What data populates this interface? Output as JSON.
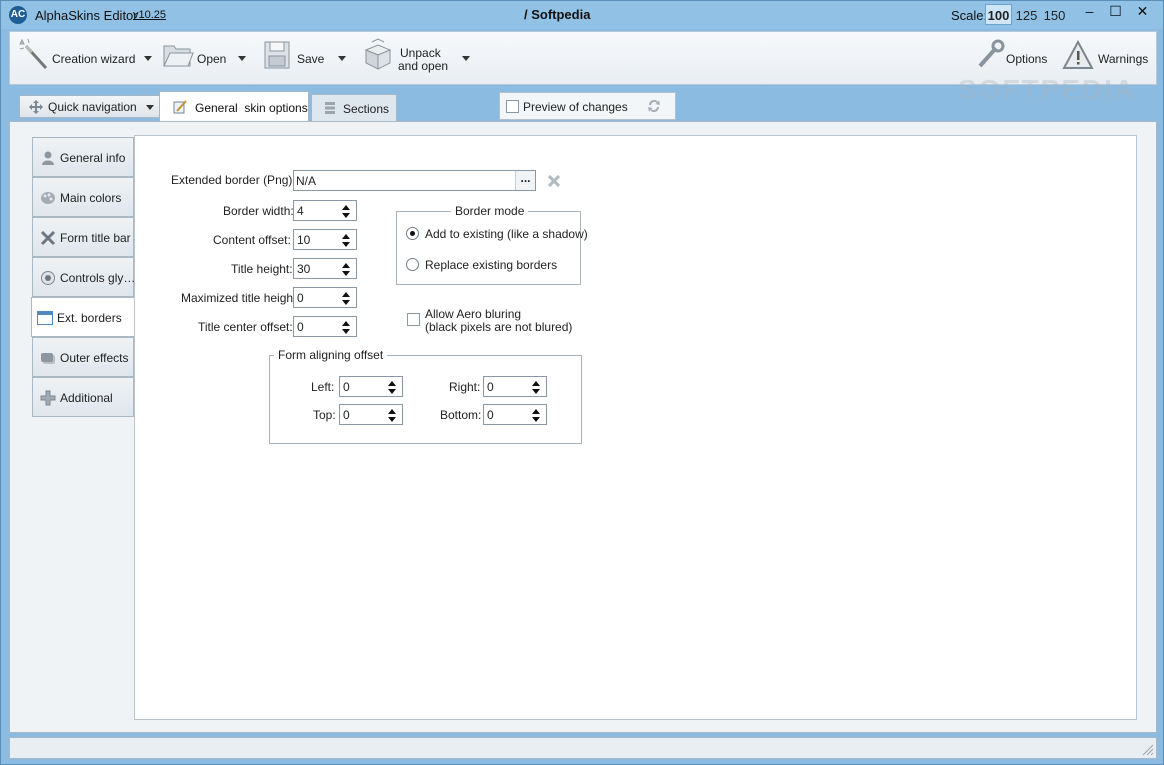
{
  "app": {
    "logo": "AC",
    "title": "AlphaSkins Editor",
    "version": "v10.25",
    "document": "/ Softpedia"
  },
  "scale": {
    "label": "Scale:",
    "options": [
      "100",
      "125",
      "150"
    ],
    "selected": "100"
  },
  "window_controls": {
    "minimize": "–",
    "maximize": "☐",
    "close": "✕"
  },
  "toolbar": {
    "creation_wizard": "Creation wizard",
    "open": "Open",
    "save": "Save",
    "unpack_line1": "Unpack",
    "unpack_line2": "and open",
    "options": "Options",
    "warnings": "Warnings",
    "watermark": "SOFTPEDIA"
  },
  "tabs": {
    "quick_navigation": "Quick navigation",
    "general": "General  skin options",
    "sections": "Sections",
    "preview": "Preview of changes"
  },
  "sidebar": {
    "items": [
      {
        "label": "General info",
        "icon": "person-icon"
      },
      {
        "label": "Main colors",
        "icon": "palette-icon"
      },
      {
        "label": "Form title bar",
        "icon": "cross-tools-icon"
      },
      {
        "label": "Controls gly…",
        "icon": "radio-glyph-icon"
      },
      {
        "label": "Ext. borders",
        "icon": "window-icon"
      },
      {
        "label": "Outer effects",
        "icon": "shadow-icon"
      },
      {
        "label": "Additional",
        "icon": "plus-puzzle-icon"
      }
    ],
    "active": "Ext. borders"
  },
  "form": {
    "extended_border_label": "Extended border (Png):",
    "extended_border_value": "N/A",
    "browse": "...",
    "border_width_label": "Border width:",
    "border_width": "4",
    "content_offset_label": "Content offset:",
    "content_offset": "10",
    "title_height_label": "Title height:",
    "title_height": "30",
    "max_title_height_label": "Maximized title height:",
    "max_title_height": "0",
    "title_center_offset_label": "Title center offset:",
    "title_center_offset": "0",
    "border_mode": {
      "title": "Border mode",
      "add": "Add to existing (like a shadow)",
      "replace": "Replace existing borders",
      "selected": "add"
    },
    "aero_line1": "Allow Aero bluring",
    "aero_line2": "(black pixels are not blured)",
    "aligning": {
      "title": "Form aligning offset",
      "left_label": "Left:",
      "left": "0",
      "right_label": "Right:",
      "right": "0",
      "top_label": "Top:",
      "top": "0",
      "bottom_label": "Bottom:",
      "bottom": "0"
    }
  }
}
